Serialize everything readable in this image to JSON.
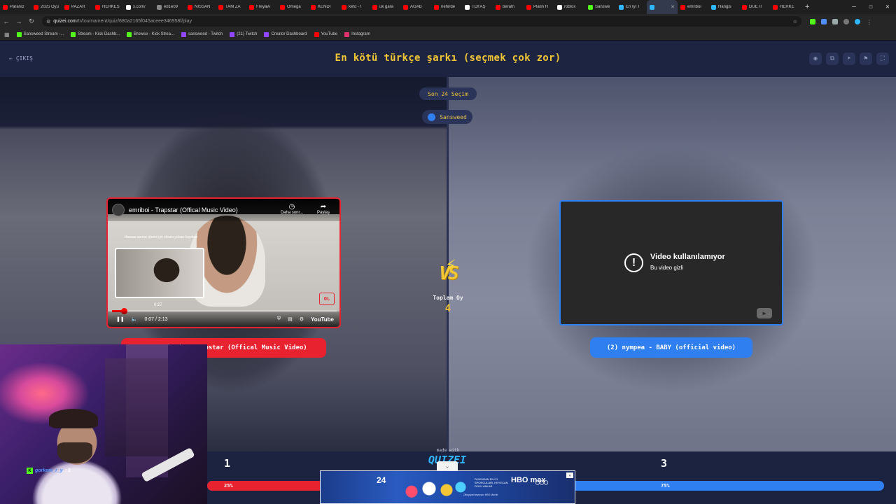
{
  "browser": {
    "tabs": [
      {
        "label": "Paranız",
        "color": "#ff0000"
      },
      {
        "label": "2025 Oyu",
        "color": "#ff0000"
      },
      {
        "label": "PAZAR",
        "color": "#ff0000"
      },
      {
        "label": "HERKES",
        "color": "#ff0000"
      },
      {
        "label": "x.com/",
        "color": "#ffffff"
      },
      {
        "label": "e81e09",
        "color": "#888888"
      },
      {
        "label": "NISSAN",
        "color": "#ff0000"
      },
      {
        "label": "TAM ZA",
        "color": "#ff0000"
      },
      {
        "label": "Freyaw",
        "color": "#ff0000"
      },
      {
        "label": "Omega",
        "color": "#ff0000"
      },
      {
        "label": "KENDİ",
        "color": "#ff0000"
      },
      {
        "label": "kefo - f",
        "color": "#ff0000"
      },
      {
        "label": "uk gara",
        "color": "#ff0000"
      },
      {
        "label": "AGAB",
        "color": "#ff0000"
      },
      {
        "label": "nehirde",
        "color": "#ff0000"
      },
      {
        "label": "TOFAŞ",
        "color": "#ffffff"
      },
      {
        "label": "beratn",
        "color": "#ff0000"
      },
      {
        "label": "Platin H",
        "color": "#ff0000"
      },
      {
        "label": "roblox",
        "color": "#ffffff"
      },
      {
        "label": "Sanswe",
        "color": "#53fc18"
      },
      {
        "label": "En İyi T",
        "color": "#2fb6ff"
      },
      {
        "label": "",
        "color": "#2fb6ff",
        "active": true
      },
      {
        "label": "emriboi",
        "color": "#ff0000"
      },
      {
        "label": "Hangis",
        "color": "#2fb6ff"
      },
      {
        "label": "DÜETİ",
        "color": "#ff0000"
      },
      {
        "label": "HERKE",
        "color": "#ff0000"
      }
    ],
    "url_host": "quizei.com",
    "url_path": "/tr/tournament/quiz/680a2165f045aceee346958f/play",
    "bookmarks": [
      {
        "label": "Sansweed Stream -...",
        "color": "#53fc18"
      },
      {
        "label": "Stream - Kick Dashb...",
        "color": "#53fc18"
      },
      {
        "label": "Browse - Kick Strea...",
        "color": "#53fc18"
      },
      {
        "label": "sansweed - Twitch",
        "color": "#9146ff"
      },
      {
        "label": "(21) Twitch",
        "color": "#9146ff"
      },
      {
        "label": "Creator Dashboard",
        "color": "#9146ff"
      },
      {
        "label": "YouTube",
        "color": "#ff0000"
      },
      {
        "label": "Instagram",
        "color": "#e1306c"
      }
    ]
  },
  "header": {
    "exit_label": "ÇIKIŞ",
    "title": "En kötü türkçe şarkı (seçmek çok zor)"
  },
  "stage": {
    "last_choice": "Son 24 Seçim",
    "user_name": "Sansweed",
    "total_label": "Toplam Oy",
    "total_value": "4"
  },
  "left": {
    "video_title": "emriboi - Trapstar (Offical Music Video)",
    "watch_later": "Daha sonr...",
    "share": "Paylaş",
    "thumb_text": "Hassas sarma işlemi için ekranı yukarı kaydırın",
    "preview_time": "0:27",
    "time": "0:07 / 2:13",
    "progress_fraction": 0.053,
    "youtube_word": "YouTube",
    "label": "(1) emriboi - Trapstar (Offical Music Video)"
  },
  "right": {
    "unavailable_title": "Video kullanılamıyor",
    "unavailable_sub": "Bu video gizli",
    "label": "(2) nympea - BABY (official video)"
  },
  "results": {
    "score_left": "1",
    "score_right": "3",
    "pct_left": "25%",
    "pct_right": "75%",
    "left_fraction": 0.25,
    "made_with": "made with",
    "brand": "QUIZEI",
    "color_left": "#e8222f",
    "color_right": "#2f7ff0"
  },
  "webcam": {
    "tag": "gorkem_r_y",
    "tag_count": ": 2"
  },
  "ad": {
    "number": "24",
    "text": "DÜNYANIN EN İYİ SPORCULARI, HEYECAN DOLU ANLAR",
    "brand": "HBO max",
    "fine": "Olimpiyat heyecanı HBO Max'te"
  }
}
